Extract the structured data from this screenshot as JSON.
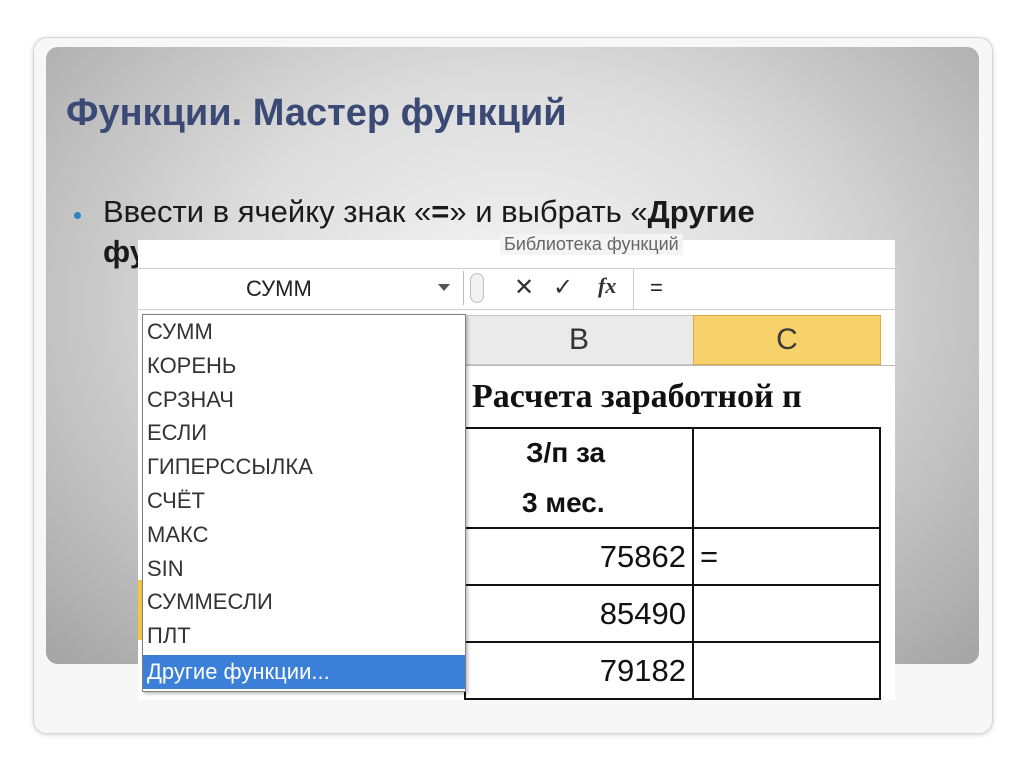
{
  "slide": {
    "title": "Функции. Мастер функций",
    "bullet_part1": "Ввести в ячейку знак «",
    "bullet_eq": "=",
    "bullet_part2": "» и выбрать «",
    "bullet_bold": "Другие",
    "bullet_line2": "фу"
  },
  "excel": {
    "ribbon_group_label": "Библиотека функций",
    "name_box_value": "СУММ",
    "cancel_symbol": "✕",
    "enter_symbol": "✓",
    "fx_label": "fx",
    "formula_value": "=",
    "columns": [
      "B",
      "C"
    ],
    "sheet_title": "Расчета заработной п",
    "header_cell_line1": "З/п за",
    "header_cell_line2": "3 мес.",
    "values": [
      "75862",
      "85490",
      "79182"
    ],
    "active_cell_value": "="
  },
  "dropdown": {
    "items": [
      "СУММ",
      "КОРЕНЬ",
      "СРЗНАЧ",
      "ЕСЛИ",
      "ГИПЕРССЫЛКА",
      "СЧЁТ",
      "МАКС",
      "SIN",
      "СУММЕСЛИ",
      "ПЛТ"
    ],
    "selected_item": "Другие функции..."
  }
}
